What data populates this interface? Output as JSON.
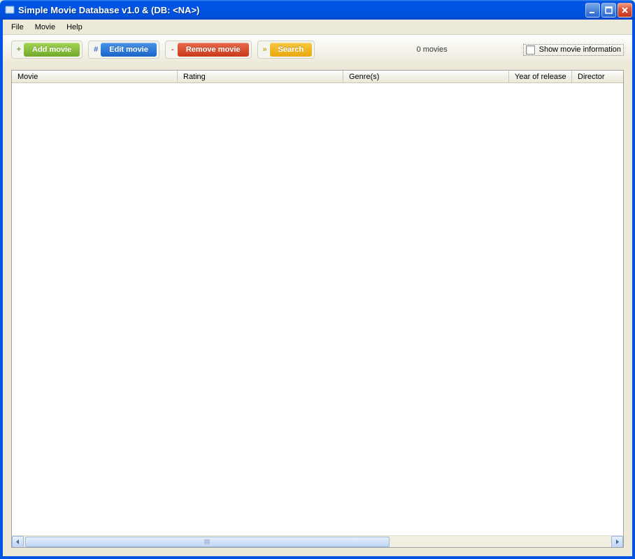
{
  "window": {
    "title": "Simple Movie Database v1.0 & (DB: <NA>)"
  },
  "menubar": {
    "items": [
      "File",
      "Movie",
      "Help"
    ]
  },
  "toolbar": {
    "add": {
      "prefix": "+",
      "label": "Add movie"
    },
    "edit": {
      "prefix": "#",
      "label": "Edit movie"
    },
    "remove": {
      "prefix": "-",
      "label": "Remove movie"
    },
    "search": {
      "prefix": "»",
      "label": "Search"
    },
    "status": "0 movies",
    "checkbox_label": "Show movie information"
  },
  "table": {
    "columns": {
      "movie": "Movie",
      "rating": "Rating",
      "genre": "Genre(s)",
      "year": "Year of release",
      "director": "Director"
    },
    "rows": []
  }
}
